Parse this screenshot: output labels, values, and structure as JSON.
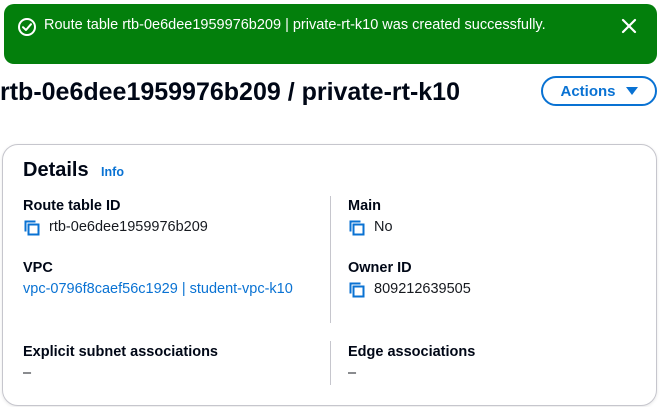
{
  "flash": {
    "message": "Route table rtb-0e6dee1959976b209 | private-rt-k10 was created successfully.",
    "color": "#037f0c"
  },
  "header": {
    "title": "rtb-0e6dee1959976b209 / private-rt-k10",
    "actions_label": "Actions"
  },
  "details": {
    "heading": "Details",
    "info_label": "Info",
    "route_table_id": {
      "label": "Route table ID",
      "value": "rtb-0e6dee1959976b209"
    },
    "main": {
      "label": "Main",
      "value": "No"
    },
    "vpc": {
      "label": "VPC",
      "value": "vpc-0796f8caef56c1929 | student-vpc-k10"
    },
    "owner_id": {
      "label": "Owner ID",
      "value": "809212639505"
    },
    "explicit_subnet_associations": {
      "label": "Explicit subnet associations",
      "value": "–"
    },
    "edge_associations": {
      "label": "Edge associations",
      "value": "–"
    }
  },
  "icons": {
    "success": "check-circle-icon",
    "close": "close-icon",
    "copy": "copy-icon",
    "dropdown": "caret-down-icon"
  },
  "colors": {
    "accent": "#0972d3",
    "success": "#037f0c",
    "text": "#16191f",
    "border": "#c6c6cd"
  }
}
